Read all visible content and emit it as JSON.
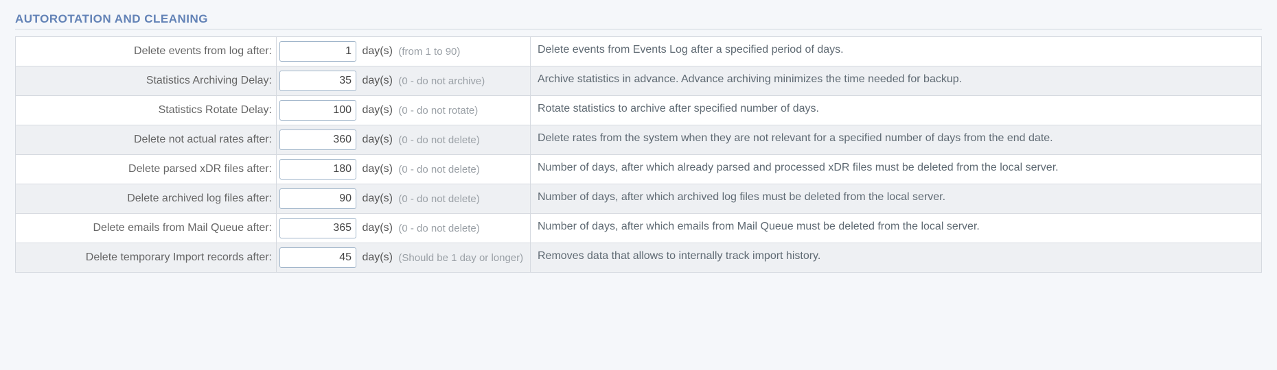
{
  "section_title": "AUTOROTATION AND CLEANING",
  "unit_label": "day(s)",
  "rows": [
    {
      "label": "Delete events from log after:",
      "value": "1",
      "hint": "(from 1 to 90)",
      "desc": "Delete events from Events Log after a specified period of days."
    },
    {
      "label": "Statistics Archiving Delay:",
      "value": "35",
      "hint": "(0 - do not archive)",
      "desc": "Archive statistics in advance. Advance archiving minimizes the time needed for backup."
    },
    {
      "label": "Statistics Rotate Delay:",
      "value": "100",
      "hint": "(0 - do not rotate)",
      "desc": "Rotate statistics to archive after specified number of days."
    },
    {
      "label": "Delete not actual rates after:",
      "value": "360",
      "hint": "(0 - do not delete)",
      "desc": "Delete rates from the system when they are not relevant for a specified number of days from the end date."
    },
    {
      "label": "Delete parsed xDR files after:",
      "value": "180",
      "hint": "(0 - do not delete)",
      "desc": "Number of days, after which already parsed and processed xDR files must be deleted from the local server."
    },
    {
      "label": "Delete archived log files after:",
      "value": "90",
      "hint": "(0 - do not delete)",
      "desc": "Number of days, after which archived log files must be deleted from the local server."
    },
    {
      "label": "Delete emails from Mail Queue after:",
      "value": "365",
      "hint": "(0 - do not delete)",
      "desc": "Number of days, after which emails from Mail Queue must be deleted from the local server."
    },
    {
      "label": "Delete temporary Import records after:",
      "value": "45",
      "hint": "(Should be 1 day or longer)",
      "desc": "Removes data that allows to internally track import history."
    }
  ]
}
